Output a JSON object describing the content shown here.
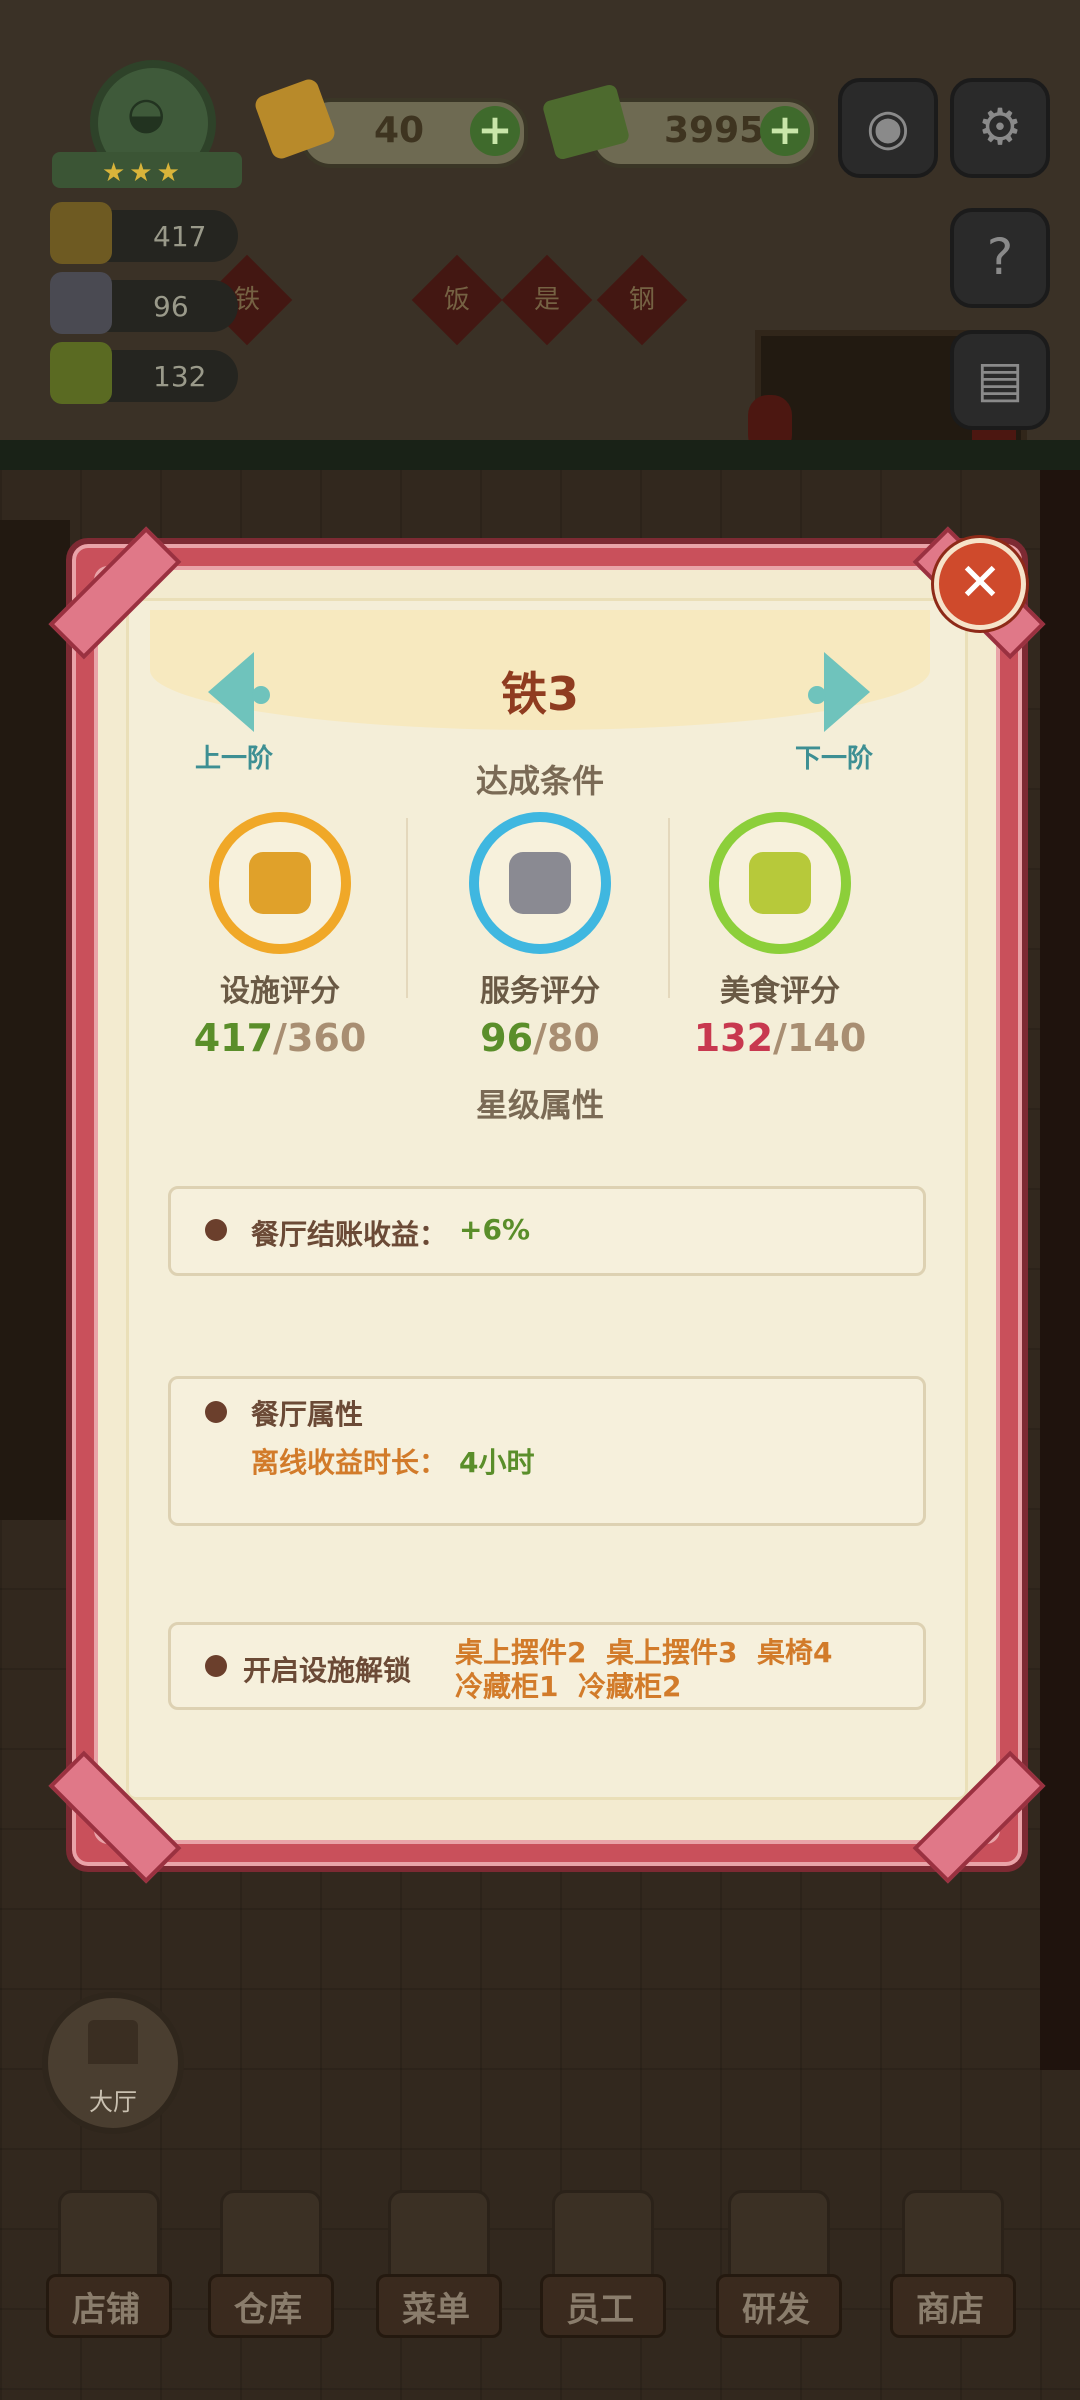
{
  "hud": {
    "gems": "40",
    "cash": "3995",
    "plus": "+",
    "camera_icon": "camera-icon",
    "settings_icon": "gear-icon",
    "help_icon": "help-book-icon",
    "stars": "★★★"
  },
  "side_stats": [
    {
      "icon": "facility-icon",
      "value": "417"
    },
    {
      "icon": "service-icon",
      "value": "96"
    },
    {
      "icon": "food-icon",
      "value": "132"
    }
  ],
  "background_banners": [
    "铁",
    "饭",
    "是",
    "钢"
  ],
  "modal": {
    "title": "铁3",
    "prev_label": "上一阶",
    "next_label": "下一阶",
    "conditions_title": "达成条件",
    "close": "✕",
    "scores": [
      {
        "label": "设施评分",
        "current": "417",
        "separator": "/",
        "required": "360",
        "met": true,
        "ring_color": "#f0a828"
      },
      {
        "label": "服务评分",
        "current": "96",
        "separator": "/",
        "required": "80",
        "met": true,
        "ring_color": "#3fb7e0"
      },
      {
        "label": "美食评分",
        "current": "132",
        "separator": "/",
        "required": "140",
        "met": false,
        "ring_color": "#8ccf3a"
      }
    ],
    "attributes_title": "星级属性",
    "attributes": {
      "checkout_label": "餐厅结账收益：",
      "checkout_value": "+6%",
      "restaurant_attr_label": "餐厅属性",
      "offline_label": "离线收益时长：",
      "offline_value": "4小时",
      "unlock_label": "开启设施解锁",
      "unlock_line1": "桌上摆件2  桌上摆件3  桌椅4",
      "unlock_line2": "冷藏柜1  冷藏柜2"
    }
  },
  "hall_button": "大厅",
  "bottom_nav": [
    "店铺",
    "仓库",
    "菜单",
    "员工",
    "研发",
    "商店"
  ]
}
